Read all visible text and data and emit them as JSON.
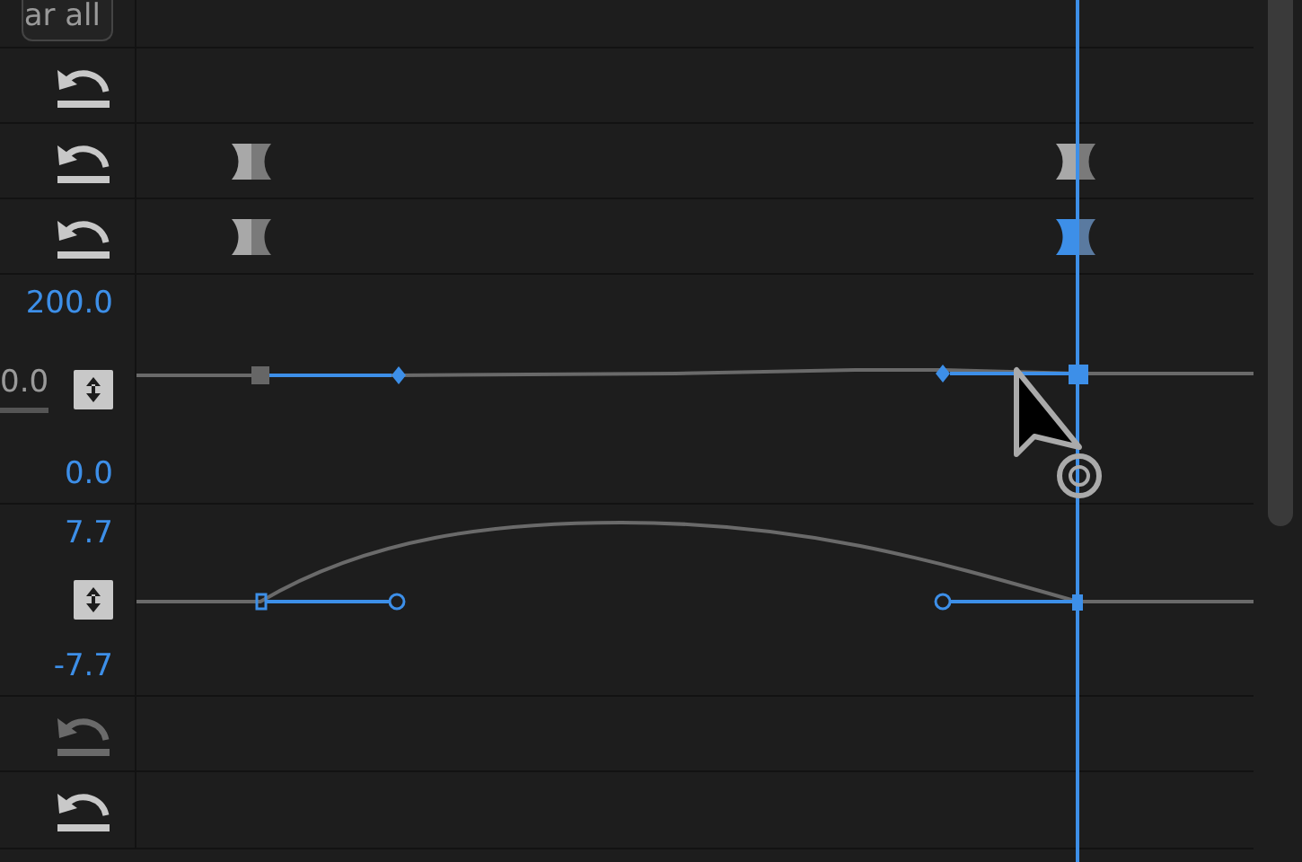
{
  "clear_button": {
    "label": "ar all"
  },
  "rows": [
    {
      "kind": "reset",
      "disabled": false
    },
    {
      "kind": "reset",
      "disabled": false,
      "keyframes": [
        {
          "selected": false
        },
        {
          "selected": false
        }
      ]
    },
    {
      "kind": "reset",
      "disabled": false,
      "keyframes": [
        {
          "selected": false
        },
        {
          "selected": true
        }
      ]
    },
    {
      "kind": "speed",
      "max": "200.0",
      "min": "0.0",
      "value": "0.0"
    },
    {
      "kind": "velocity",
      "max": "7.7",
      "min": "-7.7"
    },
    {
      "kind": "reset",
      "disabled": true
    },
    {
      "kind": "reset",
      "disabled": false
    }
  ]
}
